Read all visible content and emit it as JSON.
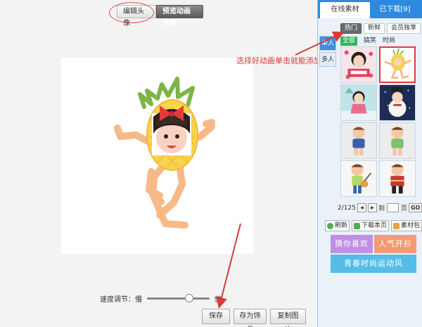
{
  "editor": {
    "tabs": [
      {
        "label": "编辑头像"
      },
      {
        "label": "预览动画效果"
      }
    ],
    "speed": {
      "label": "速度调节：慢",
      "fast_label": "快",
      "level": 0.7
    },
    "buttons": {
      "save": "保存",
      "save_deco": "存为饰品",
      "copy": "复制图片"
    },
    "annotation": "选择好动画单击就能添加"
  },
  "panel": {
    "tabs": [
      {
        "label": "在线素材"
      },
      {
        "label": "已下载[9]"
      }
    ],
    "filters": [
      "热门",
      "新鲜",
      "会员独享"
    ],
    "side_tabs": [
      "单人",
      "多人"
    ],
    "sub_filters": [
      "全部",
      "搞笑",
      "时尚"
    ],
    "thumbnails": [
      {
        "name": "love-kid"
      },
      {
        "name": "pineapple-kid"
      },
      {
        "name": "winter-kid"
      },
      {
        "name": "snowman-kid"
      },
      {
        "name": "blue-vest-kid"
      },
      {
        "name": "green-shirt-kid"
      },
      {
        "name": "guitar-kid"
      },
      {
        "name": "red-costume-kid"
      }
    ],
    "pager": {
      "current": "2/125",
      "goto_prefix": "到",
      "goto_suffix": "页",
      "go": "GO"
    },
    "tools": {
      "refresh": "刷新",
      "download_page": "下载本页",
      "pack": "素材包"
    },
    "categories": [
      "猜你喜欢",
      "人气开衫",
      "青春时尚运动风"
    ]
  },
  "colors": {
    "accent": "#2d8ae0",
    "annotation": "#d93a3a",
    "selected": "#e13b3b",
    "green": "#2db35b"
  }
}
